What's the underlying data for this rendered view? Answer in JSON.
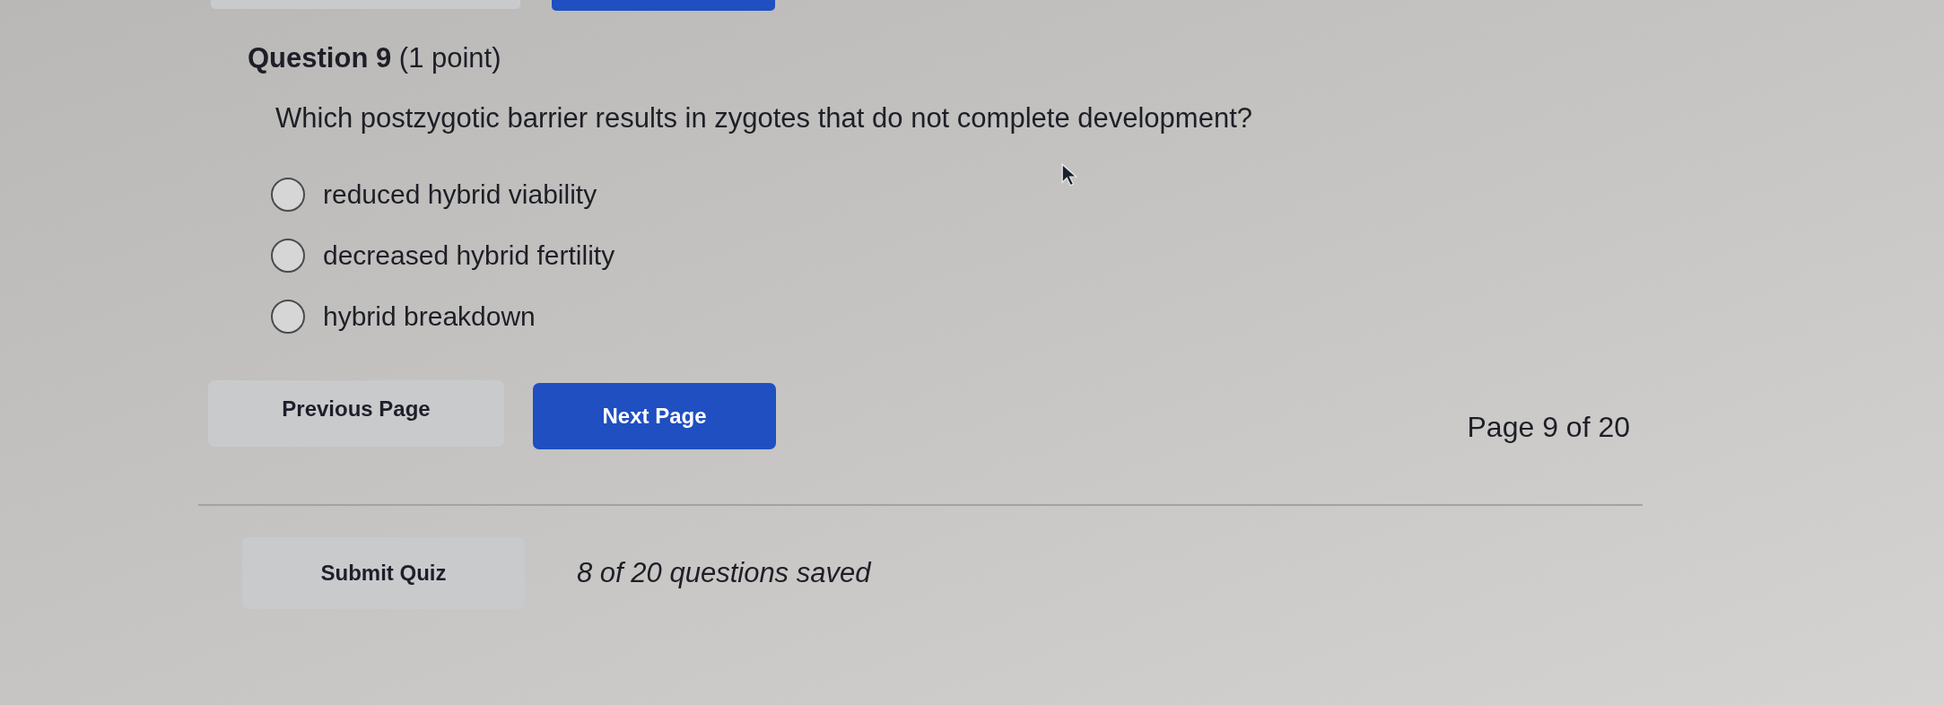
{
  "top_buttons": [
    {
      "kind": "secondary"
    },
    {
      "kind": "primary"
    }
  ],
  "question": {
    "title": "**Question 9** (1 point)",
    "text": "Which postzygotic barrier results in zygotes that do not complete development?",
    "options": [
      {
        "label": "reduced hybrid viability",
        "selected": false
      },
      {
        "label": "decreased hybrid fertility",
        "selected": false
      },
      {
        "label": "hybrid breakdown",
        "selected": false
      }
    ]
  },
  "navigation": {
    "buttons": [
      {
        "label": "Previous Page",
        "kind": "secondary"
      },
      {
        "label": "Next Page",
        "kind": "primary"
      }
    ],
    "page_indicator": "Page 9 of 20"
  },
  "footer": {
    "submit_button": "Submit Quiz",
    "save_status": "8 of 20 questions saved"
  }
}
